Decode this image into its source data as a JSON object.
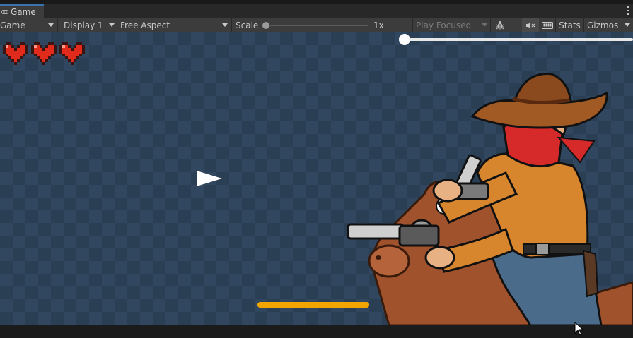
{
  "window": {
    "tab_label": "Game",
    "tab_icon": "gamepad-icon"
  },
  "toolbar": {
    "view_mode": "Game",
    "display": "Display 1",
    "aspect": "Free Aspect",
    "scale_label": "Scale",
    "scale_value": "1x",
    "play_mode": "Play Focused",
    "stats_label": "Stats",
    "gizmos_label": "Gizmos",
    "icons": [
      "bug-icon",
      "mute-audio-icon",
      "keyboard-icon",
      "chevron-down-icon"
    ]
  },
  "game": {
    "hearts_count": 3,
    "heart_color": "#e02a1c",
    "slider_value": 0,
    "progress_bar_fill": 1.0,
    "progress_bar_color": "#f2a500",
    "accent_tab_color": "#3a72b0"
  }
}
